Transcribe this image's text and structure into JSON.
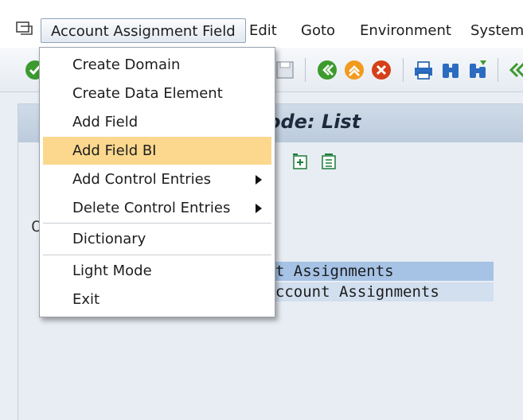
{
  "menubar": {
    "items": [
      {
        "label": "Account Assignment Field"
      },
      {
        "label": "Edit"
      },
      {
        "label": "Goto"
      },
      {
        "label": "Environment"
      },
      {
        "label": "System"
      }
    ]
  },
  "toolbar": {
    "icons": [
      "checkmark-icon",
      "save-icon",
      "back-icon",
      "exit-icon",
      "cancel-icon",
      "print-icon",
      "find-icon",
      "find-next-icon",
      "first-page-icon"
    ]
  },
  "content": {
    "title": "ode: List",
    "cut_char": "C",
    "rows": [
      {
        "text": "unt Assignments"
      },
      {
        "text": "Acccount Assignments"
      }
    ]
  },
  "dropdown": {
    "items": [
      {
        "label": "Create Domain",
        "highlighted": false,
        "submenu": false
      },
      {
        "label": "Create Data Element",
        "highlighted": false,
        "submenu": false
      },
      {
        "label": "Add Field",
        "highlighted": false,
        "submenu": false
      },
      {
        "label": "Add Field BI",
        "highlighted": true,
        "submenu": false
      },
      {
        "label": "Add Control Entries",
        "highlighted": false,
        "submenu": true
      },
      {
        "label": "Delete Control Entries",
        "highlighted": false,
        "submenu": true
      },
      {
        "label": "Dictionary",
        "highlighted": false,
        "submenu": false
      },
      {
        "label": "Light Mode",
        "highlighted": false,
        "submenu": false
      },
      {
        "label": "Exit",
        "highlighted": false,
        "submenu": false
      }
    ]
  },
  "colors": {
    "highlight": "#fbd88e",
    "selected_row": "#a6c3e6",
    "title_band": "#c3d1e1"
  }
}
